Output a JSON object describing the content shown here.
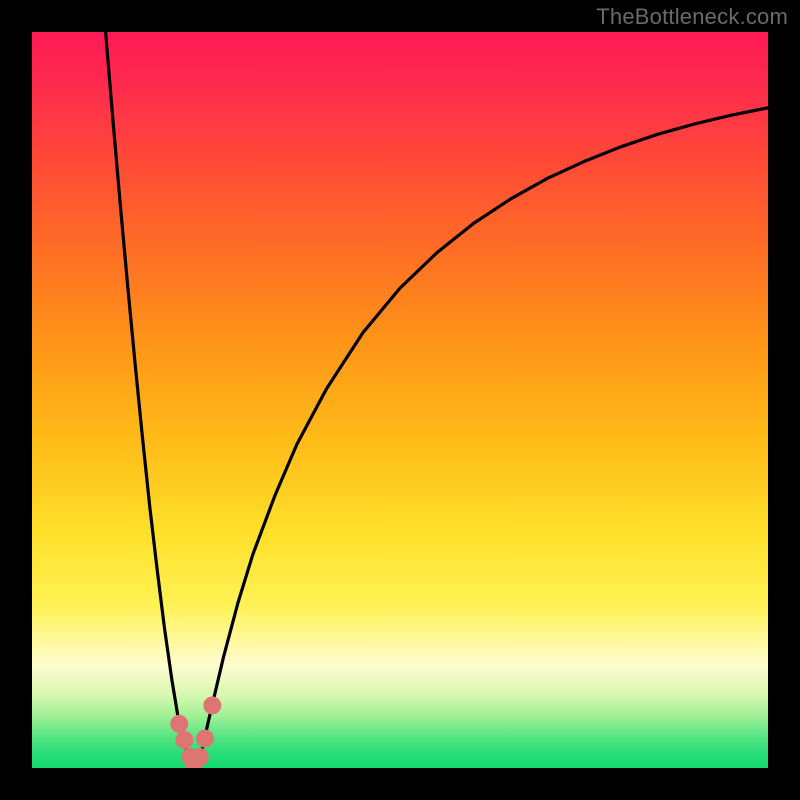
{
  "watermark": "TheBottleneck.com",
  "gradient_stops": [
    {
      "offset": 0.0,
      "color": "#ff1a55"
    },
    {
      "offset": 0.07,
      "color": "#ff2a4d"
    },
    {
      "offset": 0.18,
      "color": "#ff4b36"
    },
    {
      "offset": 0.3,
      "color": "#ff6f24"
    },
    {
      "offset": 0.42,
      "color": "#ff9418"
    },
    {
      "offset": 0.55,
      "color": "#ffba18"
    },
    {
      "offset": 0.68,
      "color": "#ffe02a"
    },
    {
      "offset": 0.78,
      "color": "#fff255"
    },
    {
      "offset": 0.86,
      "color": "#fffccf"
    },
    {
      "offset": 0.9,
      "color": "#d9f8b0"
    },
    {
      "offset": 0.93,
      "color": "#9fef96"
    },
    {
      "offset": 0.96,
      "color": "#4fe481"
    },
    {
      "offset": 0.985,
      "color": "#1fdd76"
    },
    {
      "offset": 1.0,
      "color": "#15d96f"
    }
  ],
  "chart_data": {
    "type": "line",
    "title": "",
    "xlabel": "",
    "ylabel": "",
    "xlim": [
      0,
      100
    ],
    "ylim": [
      0,
      100
    ],
    "series": [
      {
        "name": "bottleneck-curve",
        "x": [
          10.0,
          11.0,
          12.0,
          13.0,
          14.0,
          15.0,
          16.0,
          17.0,
          18.0,
          19.0,
          20.0,
          21.0,
          22.0,
          23.0,
          24.0,
          26.0,
          28.0,
          30.0,
          33.0,
          36.0,
          40.0,
          45.0,
          50.0,
          55.0,
          60.0,
          65.0,
          70.0,
          75.0,
          80.0,
          85.0,
          90.0,
          95.0,
          100.0
        ],
        "y": [
          100.0,
          88.0,
          76.5,
          65.5,
          55.0,
          45.0,
          35.5,
          27.0,
          19.0,
          12.0,
          6.0,
          2.5,
          0.5,
          2.0,
          6.5,
          15.0,
          22.5,
          29.0,
          37.0,
          44.0,
          51.5,
          59.2,
          65.2,
          70.0,
          74.0,
          77.3,
          80.1,
          82.4,
          84.4,
          86.1,
          87.5,
          88.7,
          89.7
        ]
      }
    ],
    "markers": {
      "name": "highlight-points",
      "color": "#dd7572",
      "points": [
        {
          "x": 20.0,
          "y": 6.0
        },
        {
          "x": 20.7,
          "y": 3.8
        },
        {
          "x": 21.5,
          "y": 1.5
        },
        {
          "x": 22.0,
          "y": 0.6
        },
        {
          "x": 22.8,
          "y": 1.5
        },
        {
          "x": 23.5,
          "y": 4.0
        },
        {
          "x": 24.5,
          "y": 8.5
        }
      ]
    }
  }
}
